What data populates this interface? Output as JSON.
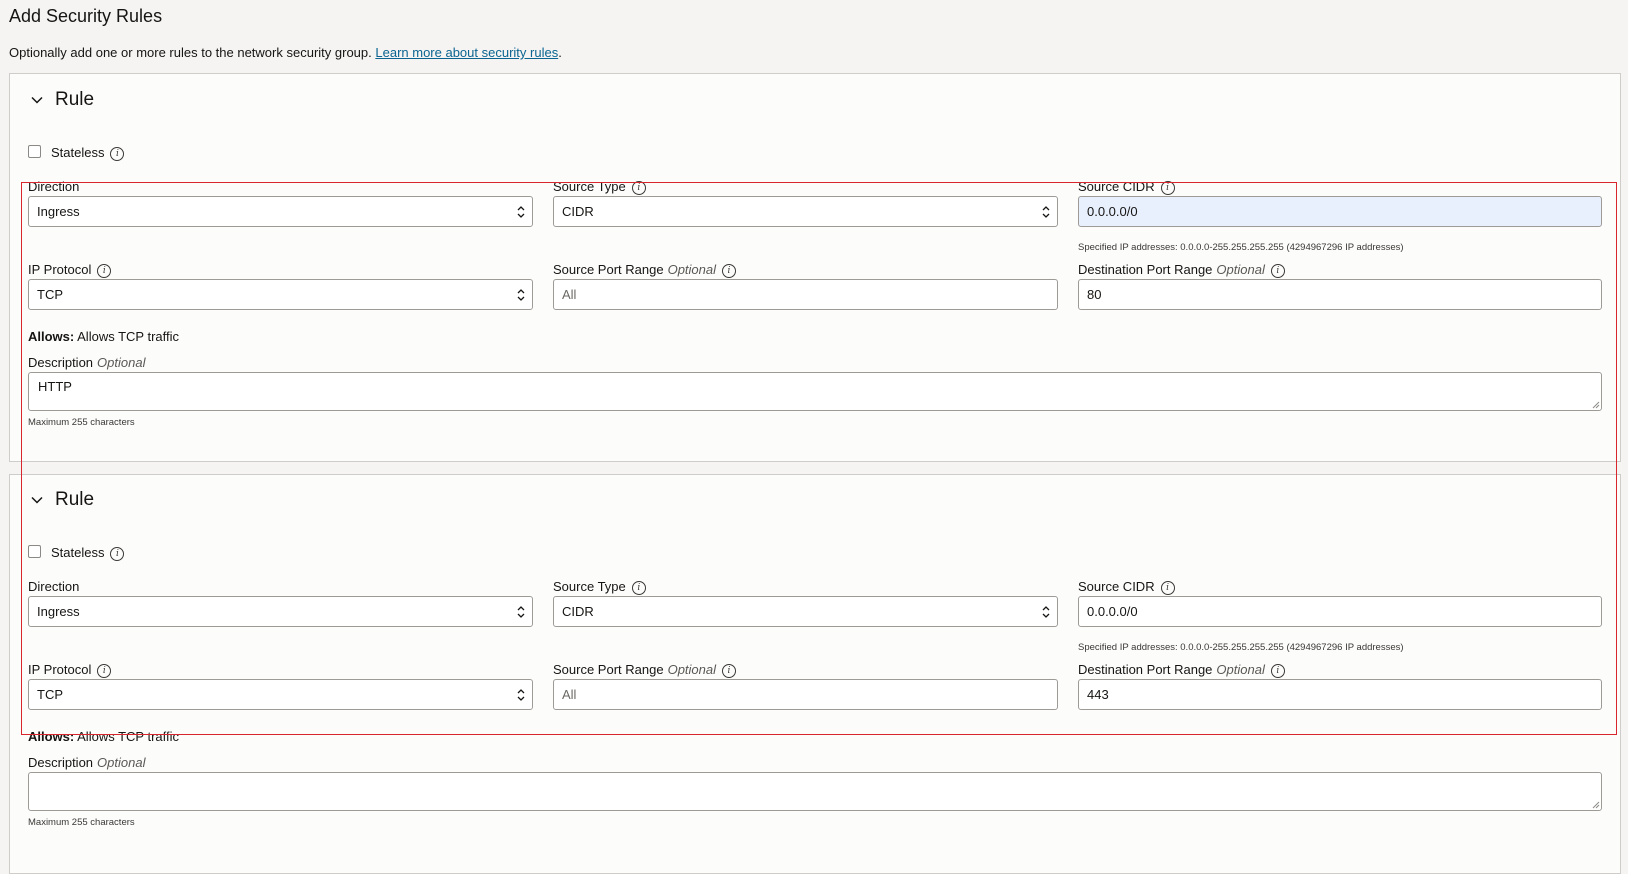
{
  "page": {
    "title": "Add Security Rules",
    "description": "Optionally add one or more rules to the network security group.",
    "learn_more_link": "Learn more about security rules",
    "description_suffix": "."
  },
  "labels": {
    "rule_title": "Rule",
    "stateless": "Stateless",
    "direction": "Direction",
    "source_type": "Source Type",
    "source_cidr": "Source CIDR",
    "ip_protocol": "IP Protocol",
    "source_port_range": "Source Port Range",
    "destination_port_range": "Destination Port Range",
    "optional": "Optional",
    "allows_prefix": "Allows:",
    "description": "Description",
    "max_chars": "Maximum 255 characters"
  },
  "rules": [
    {
      "stateless_checked": false,
      "direction": "Ingress",
      "source_type": "CIDR",
      "source_cidr": "0.0.0.0/0",
      "source_cidr_helper": "Specified IP addresses: 0.0.0.0-255.255.255.255 (4294967296 IP addresses)",
      "ip_protocol": "TCP",
      "source_port_range_placeholder": "All",
      "destination_port_range": "80",
      "allows_text": "Allows TCP traffic",
      "description_value": "HTTP"
    },
    {
      "stateless_checked": false,
      "direction": "Ingress",
      "source_type": "CIDR",
      "source_cidr": "0.0.0.0/0",
      "source_cidr_helper": "Specified IP addresses: 0.0.0.0-255.255.255.255 (4294967296 IP addresses)",
      "ip_protocol": "TCP",
      "source_port_range_placeholder": "All",
      "destination_port_range": "443",
      "allows_text": "Allows TCP traffic",
      "description_value": ""
    }
  ],
  "colors": {
    "page_background": "#f5f4f2",
    "panel_background": "#fcfcfb",
    "link": "#0b6491",
    "highlight_box": "#d9262e",
    "focused_input": "#e8f0fe"
  },
  "icons": {
    "collapse": "chevron-down-icon",
    "info": "info-icon",
    "select": "select-arrows-icon",
    "resize": "resize-grip-icon"
  }
}
